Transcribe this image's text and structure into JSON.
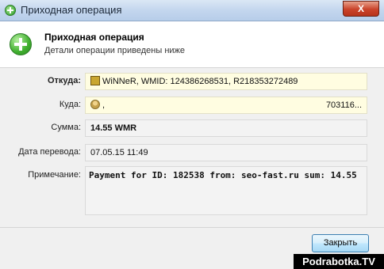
{
  "window": {
    "title": "Приходная операция",
    "close_label": "X"
  },
  "header": {
    "title": "Приходная операция",
    "subtitle": "Детали операции приведены ниже"
  },
  "fields": {
    "from": {
      "label": "Откуда:",
      "value": "WiNNeR, WMID: 124386268531, R218353272489"
    },
    "to": {
      "label": "Куда:",
      "value_start": ",",
      "value_end": "703116..."
    },
    "amount": {
      "label": "Сумма:",
      "value": "14.55 WMR"
    },
    "date": {
      "label": "Дата перевода:",
      "value": "07.05.15 11:49"
    },
    "note": {
      "label": "Примечание:",
      "value": "Payment for ID: 182538 from: seo-fast.ru sum: 14.55"
    }
  },
  "footer": {
    "close_button": "Закрыть"
  },
  "watermark": "Podrabotka.TV",
  "icons": {
    "title_icon": "green-plus-icon",
    "header_icon": "green-plus-icon",
    "from_icon": "passport-icon",
    "to_icon": "person-icon"
  }
}
